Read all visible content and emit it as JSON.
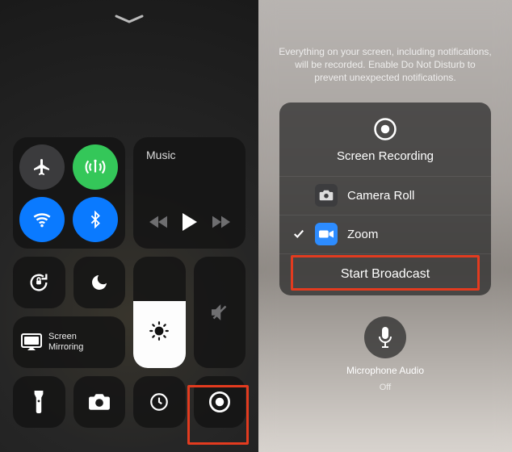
{
  "left": {
    "music_label": "Music",
    "mirror_label": "Screen\nMirroring"
  },
  "right": {
    "info": "Everything on your screen, including notifications, will be recorded. Enable Do Not Disturb to prevent unexpected notifications.",
    "sheet_title": "Screen Recording",
    "rows": {
      "camera_roll": "Camera Roll",
      "zoom": "Zoom"
    },
    "broadcast_label": "Start Broadcast",
    "mic_label": "Microphone Audio",
    "mic_state": "Off"
  }
}
